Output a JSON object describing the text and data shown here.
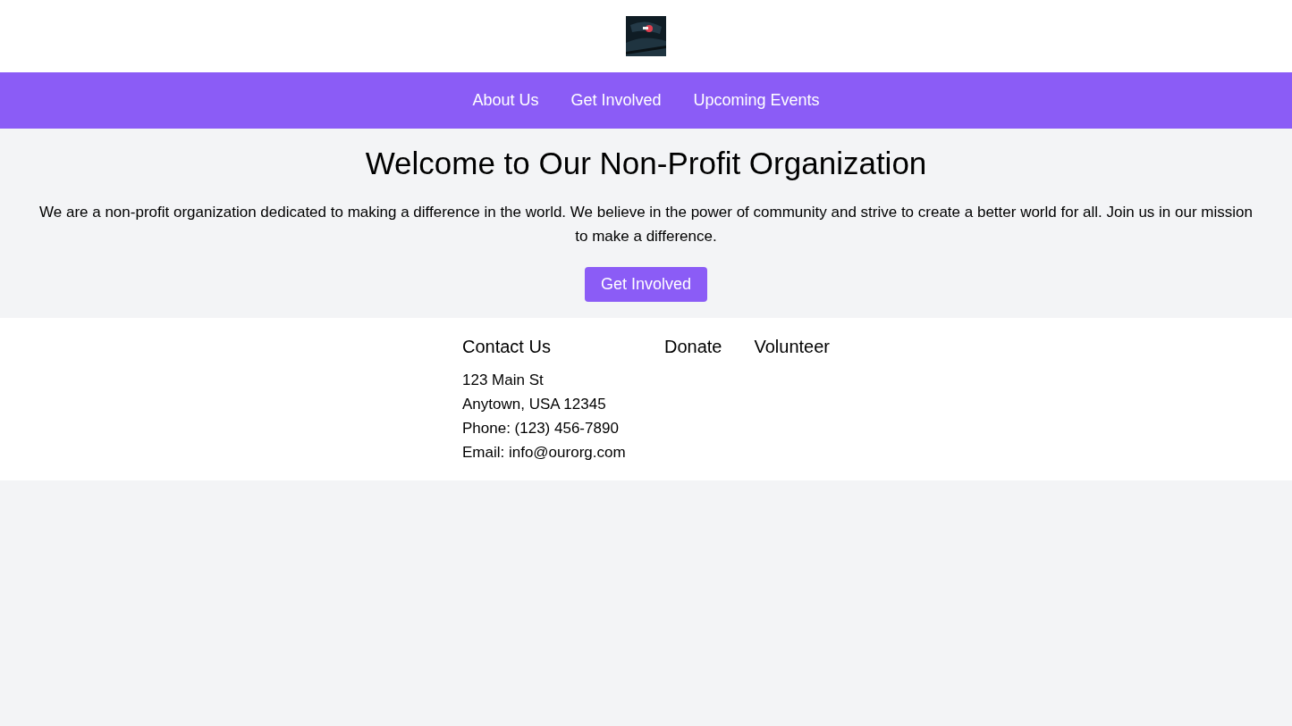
{
  "nav": {
    "links": [
      "About Us",
      "Get Involved",
      "Upcoming Events"
    ]
  },
  "hero": {
    "title": "Welcome to Our Non-Profit Organization",
    "text": "We are a non-profit organization dedicated to making a difference in the world. We believe in the power of community and strive to create a better world for all. Join us in our mission to make a difference.",
    "button": "Get Involved"
  },
  "footer": {
    "columns": [
      {
        "heading": "Contact Us",
        "lines": [
          "123 Main St",
          "Anytown, USA 12345",
          "Phone: (123) 456-7890",
          "Email: info@ourorg.com"
        ]
      },
      {
        "heading": "Donate"
      },
      {
        "heading": "Volunteer"
      }
    ]
  }
}
